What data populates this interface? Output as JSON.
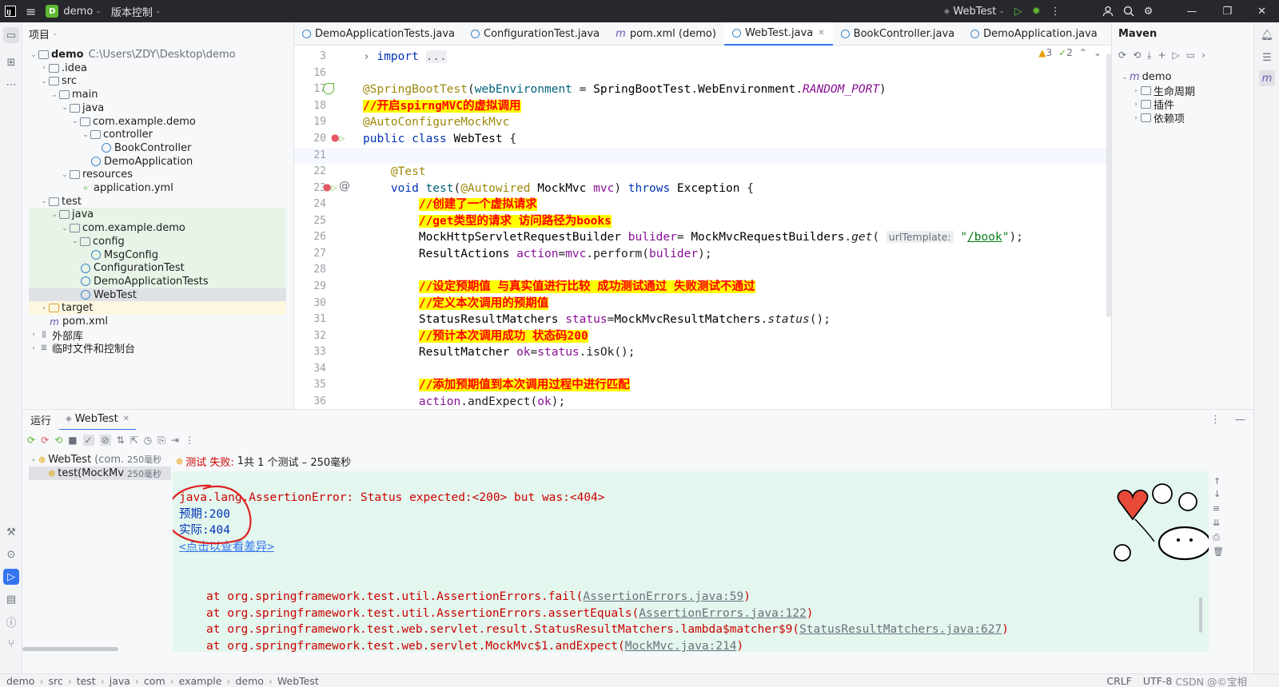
{
  "titlebar": {
    "project_badge": "D",
    "project_name": "demo",
    "vcs_label": "版本控制",
    "run_config": "WebTest"
  },
  "project_panel": {
    "title": "项目",
    "tree": [
      {
        "label": "demo",
        "path": "C:\\Users\\ZDY\\Desktop\\demo"
      },
      {
        "label": ".idea"
      },
      {
        "label": "src"
      },
      {
        "label": "main"
      },
      {
        "label": "java"
      },
      {
        "label": "com.example.demo"
      },
      {
        "label": "controller"
      },
      {
        "label": "BookController"
      },
      {
        "label": "DemoApplication"
      },
      {
        "label": "resources"
      },
      {
        "label": "application.yml"
      },
      {
        "label": "test"
      },
      {
        "label": "java"
      },
      {
        "label": "com.example.demo"
      },
      {
        "label": "config"
      },
      {
        "label": "MsgConfig"
      },
      {
        "label": "ConfigurationTest"
      },
      {
        "label": "DemoApplicationTests"
      },
      {
        "label": "WebTest"
      },
      {
        "label": "target"
      },
      {
        "label": "pom.xml"
      },
      {
        "label": "外部库"
      },
      {
        "label": "临时文件和控制台"
      }
    ]
  },
  "tabs": [
    {
      "label": "DemoApplicationTests.java"
    },
    {
      "label": "ConfigurationTest.java"
    },
    {
      "label": "pom.xml (demo)"
    },
    {
      "label": "WebTest.java"
    },
    {
      "label": "BookController.java"
    },
    {
      "label": "DemoApplication.java"
    }
  ],
  "editor": {
    "inspection_warnings": "3",
    "inspection_ok": "2",
    "line_numbers": [
      "3",
      "16",
      "17",
      "18",
      "19",
      "20",
      "21",
      "22",
      "23",
      "24",
      "25",
      "26",
      "27",
      "28",
      "29",
      "30",
      "31",
      "32",
      "33",
      "34",
      "35",
      "36"
    ],
    "import_fold": "...",
    "hint_url_template": "urlTemplate:",
    "book_path": "/book"
  },
  "maven": {
    "title": "Maven",
    "project": "demo",
    "items": [
      "生命周期",
      "插件",
      "依赖项"
    ]
  },
  "run_panel": {
    "title": "运行",
    "tab": "WebTest",
    "tree": [
      {
        "label": "WebTest",
        "detail": "(com.",
        "time": "250毫秒"
      },
      {
        "label": "test(MockMv",
        "time": "250毫秒"
      }
    ],
    "status_prefix": "测试 失败:",
    "status_count": "1",
    "status_rest": "共 1 个测试 – 250毫秒"
  },
  "console": {
    "error": "java.lang.AssertionError: Status expected:<200> but was:<404>",
    "expected": "预期:200",
    "actual": "实际:404",
    "diff_link": "<点击以查看差异>",
    "stack": [
      {
        "prefix": "at org.springframework.test.util.AssertionErrors.fail(",
        "link": "AssertionErrors.java:59",
        "suffix": ")"
      },
      {
        "prefix": "at org.springframework.test.util.AssertionErrors.assertEquals(",
        "link": "AssertionErrors.java:122",
        "suffix": ")"
      },
      {
        "prefix": "at org.springframework.test.web.servlet.result.StatusResultMatchers.lambda$matcher$9(",
        "link": "StatusResultMatchers.java:627",
        "suffix": ")"
      },
      {
        "prefix": "at org.springframework.test.web.servlet.MockMvc$1.andExpect(",
        "link": "MockMvc.java:214",
        "suffix": ")"
      }
    ]
  },
  "statusbar": {
    "breadcrumb": [
      "demo",
      "src",
      "test",
      "java",
      "com",
      "example",
      "demo",
      "WebTest"
    ],
    "line_ending": "CRLF",
    "encoding": "UTF-8",
    "watermark": "CSDN @©宝相"
  }
}
